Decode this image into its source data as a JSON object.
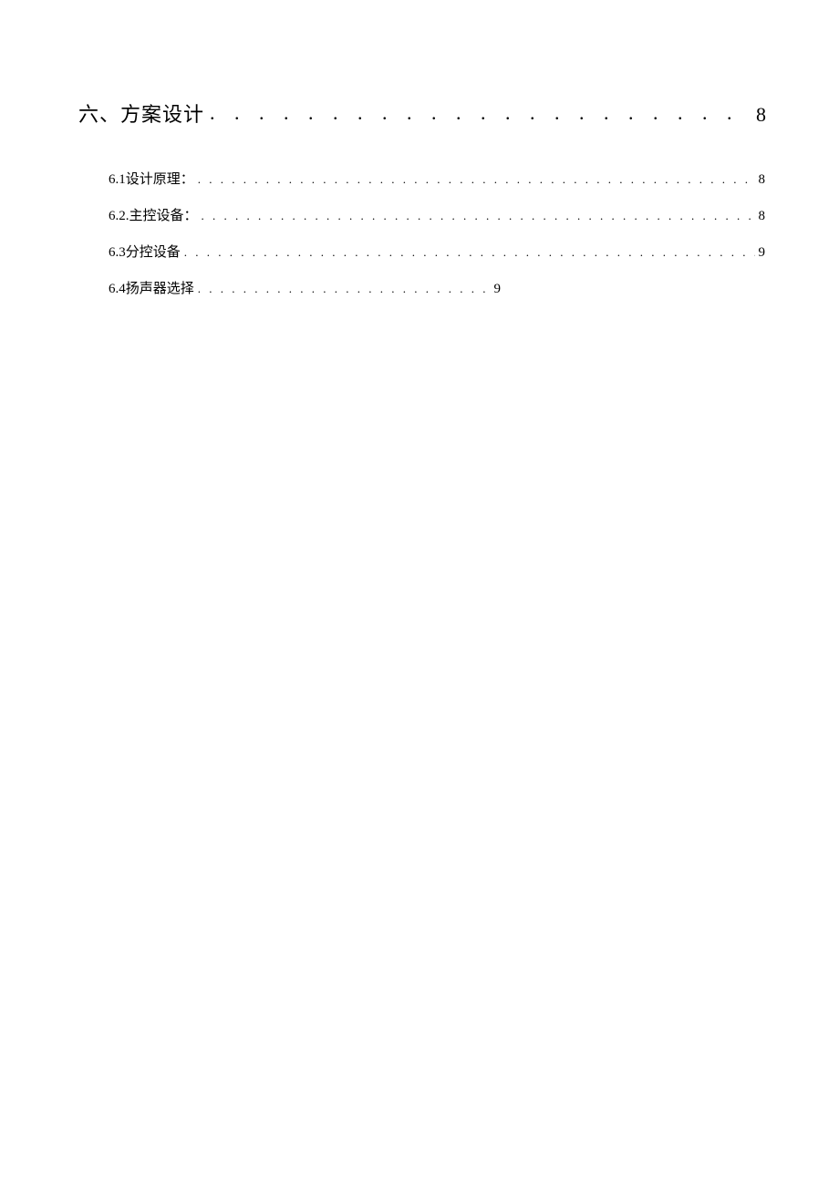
{
  "toc": {
    "main": {
      "title": "六、方案设计",
      "page": "8"
    },
    "subs": [
      {
        "title": "6.1设计原理：",
        "page": "8",
        "short": false
      },
      {
        "title": "6.2.主控设备：",
        "page": "8",
        "short": false
      },
      {
        "title": "6.3分控设备",
        "page": "9",
        "short": false
      },
      {
        "title": "6.4扬声器选择",
        "page": "9",
        "short": true
      }
    ],
    "leader_main": ". . . . . . . . . . . . . . . . . . . . . . . . . . . . . . . . . . . . . . . . . . . . . . . . . . . . . . . . . . . .",
    "leader_sub": ". . . . . . . . . . . . . . . . . . . . . . . . . . . . . . . . . . . . . . . . . . . . . . . . . . . . . . . . . . . . . . . . . . . . . . . . . . . . . . . . . . . . . . . . . . . . . . . . . . . . . . . . . . . . . . . . . . . . . . . ."
  }
}
